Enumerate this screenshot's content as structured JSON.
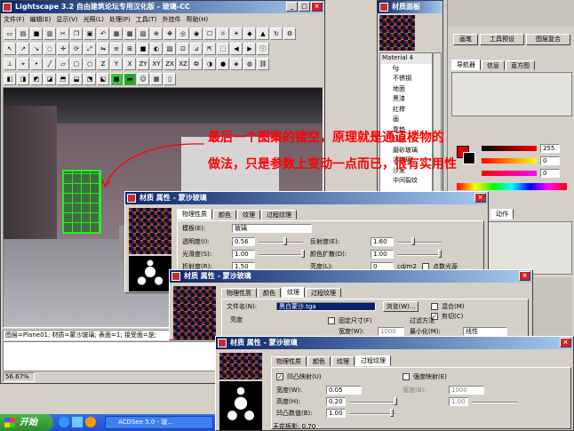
{
  "main_window": {
    "title": "Lightscape 3.2 自由建筑论坛专用汉化版 - 玻璃-CC",
    "menu": [
      "文件(F)",
      "编辑(E)",
      "显示(V)",
      "光照(L)",
      "处理(P)",
      "工具(T)",
      "外挂件",
      "帮助(H)"
    ],
    "status_text": "图层=Plane01; 材质=蒙沙玻璃; 表面=1; 接受面=是;",
    "zoom": "56.67%",
    "toolbar_row3_letters": [
      "Z",
      "Y",
      "X",
      "ZY",
      "XY",
      "ZX",
      "XZ"
    ]
  },
  "annotation": {
    "line1": "最后一个图案的镂空，原理就是通道楼物的",
    "line2": "做法，只是参数上变动一点而已，很有实用性"
  },
  "material_panel": {
    "title": "材质面板",
    "header": "Material 4",
    "items": [
      "fg",
      "不锈钢",
      "地面",
      "黑漆",
      "红榉",
      "画",
      "靠垫",
      "抉环",
      "磨砂玻璃",
      "清玻璃",
      "沙发",
      "中间裂纹"
    ]
  },
  "right_panel": {
    "buttons": [
      "画笔",
      "工具预设",
      "图层复合"
    ],
    "tabs": [
      "导航器",
      "信息",
      "直方图"
    ],
    "color_values": [
      "255",
      "0",
      "0"
    ],
    "action_tab": "动作"
  },
  "dialog1": {
    "title": "材质 属性 - 蒙沙玻璃",
    "tabs": [
      "物理性质",
      "颜色",
      "纹理",
      "过程纹理"
    ],
    "template_label": "模板(E):",
    "template_value": "玻璃",
    "transparency_label": "透明度(I):",
    "transparency_value": "0.56",
    "smoothness_label": "光滑度(S):",
    "smoothness_value": "1.00",
    "refraction_label": "折射度(R):",
    "refraction_value": "1.50",
    "reflection_label": "反射度(E):",
    "reflection_value": "1.60",
    "color_diffuse_label": "颜色扩散(D):",
    "color_diffuse_value": "1.00",
    "brightness_label": "亮度(L):",
    "brightness_value": "0",
    "brightness_unit": "cd/m2",
    "point_light_label": "点数光源"
  },
  "dialog2": {
    "title": "材质 属性 - 蒙沙玻璃",
    "tabs": [
      "物理性质",
      "颜色",
      "纹理",
      "过程纹理"
    ],
    "filename_label": "文件名(N):",
    "filename_value": "黑白蒙沙.tga",
    "browse_label": "浏览(W)...",
    "blend_label": "混合(M)",
    "cut_label": "剪切(C)",
    "brightness_label": "亮度",
    "fixed_size_label": "固定尺寸(F)",
    "width_label": "宽度(W):",
    "width_value": "1000",
    "filter_label": "过滤方法",
    "minimize_label": "最小化(M):",
    "minimize_value": "线性"
  },
  "dialog3": {
    "title": "材质 属性 - 蒙沙玻璃",
    "tabs": [
      "物理性质",
      "颜色",
      "纹理",
      "过程纹理"
    ],
    "bump_label": "凹凸映射(U)",
    "intensity_label": "强度映射(E)",
    "width_label": "宽度(W):",
    "width_value": "0.05",
    "width2_label": "宽度(B):",
    "width2_value": "1000",
    "height_label": "高度(H):",
    "height_value": "0.20",
    "height2_value": "1.00",
    "bump_value_label": "凹凸数值(B):",
    "bump_value": "1.00",
    "bottom_text": "天花板影: 0.70"
  },
  "taskbar": {
    "start": "开始",
    "task": "ACDSee 5.0 - 玻..."
  }
}
